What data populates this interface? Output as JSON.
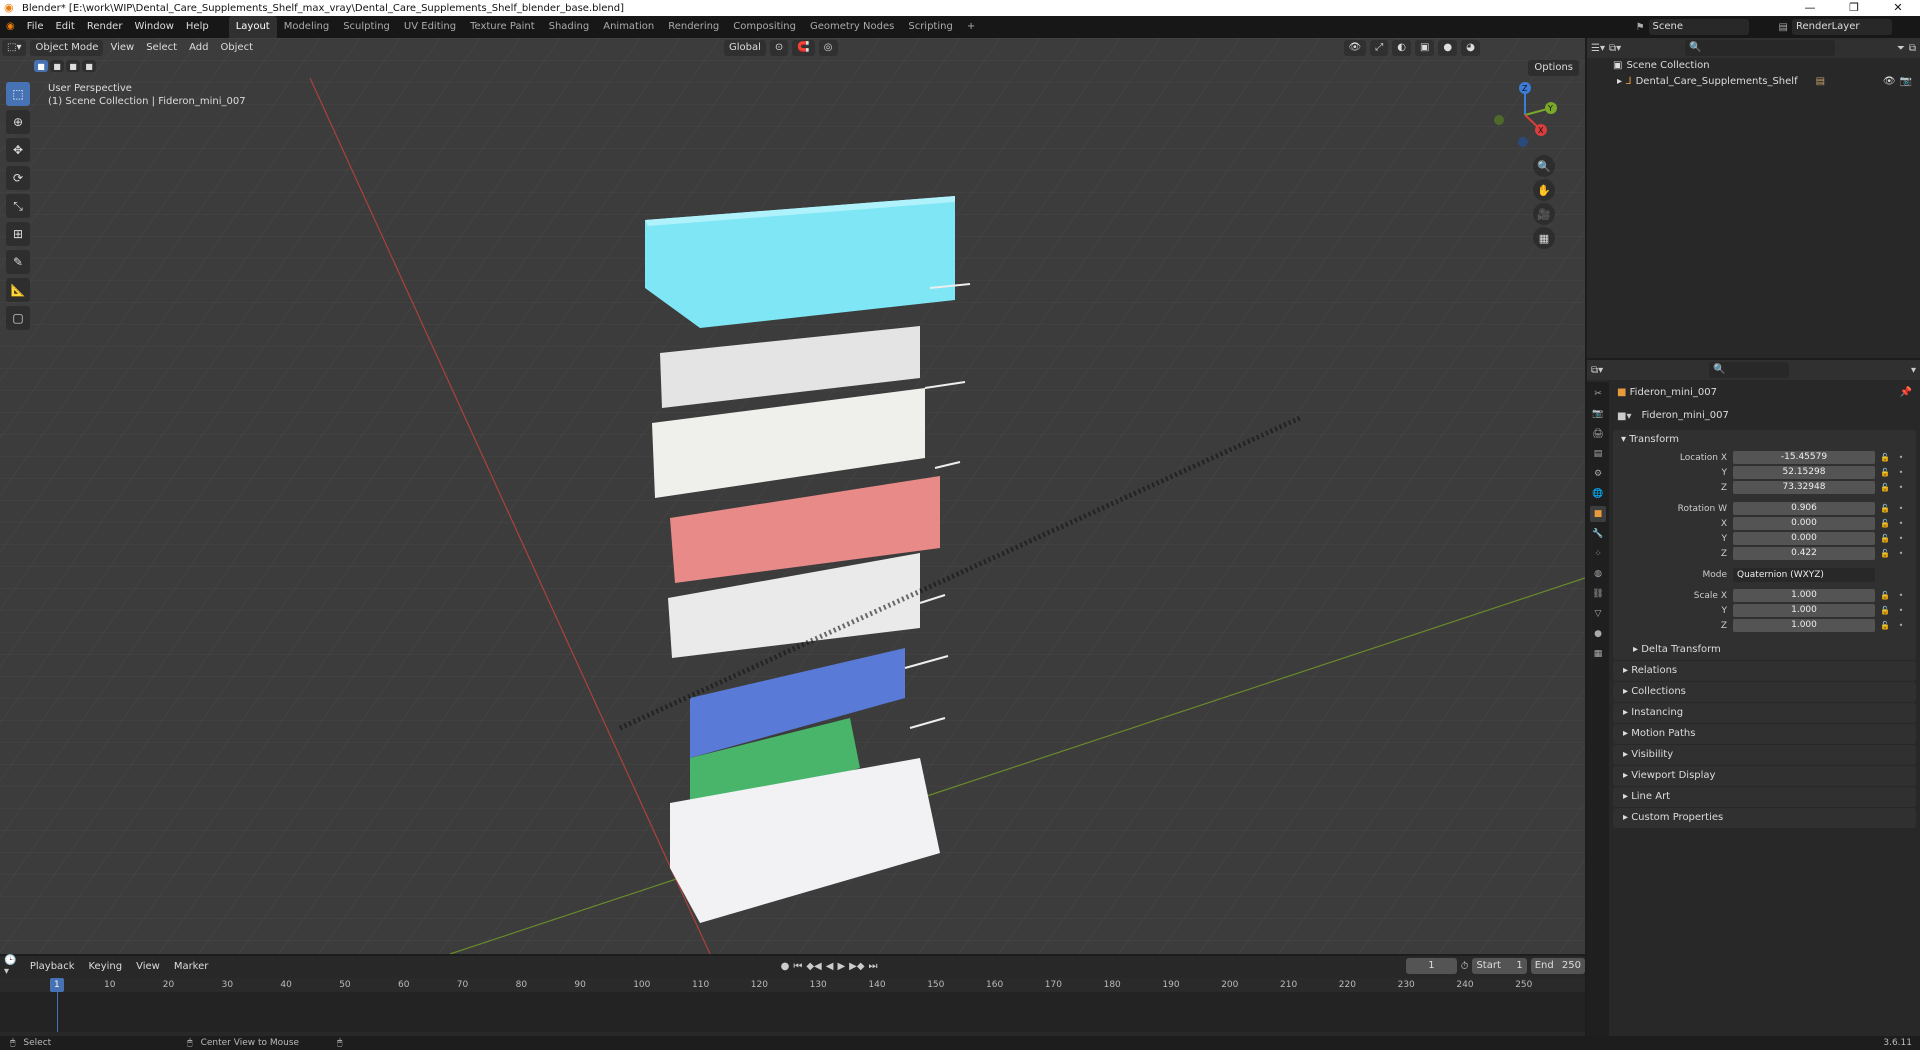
{
  "title": "Blender* [E:\\work\\WIP\\Dental_Care_Supplements_Shelf_max_vray\\Dental_Care_Supplements_Shelf_blender_base.blend]",
  "menu": [
    "File",
    "Edit",
    "Render",
    "Window",
    "Help"
  ],
  "workspaces": [
    "Layout",
    "Modeling",
    "Sculpting",
    "UV Editing",
    "Texture Paint",
    "Shading",
    "Animation",
    "Rendering",
    "Compositing",
    "Geometry Nodes",
    "Scripting",
    "+"
  ],
  "scene": "Scene",
  "render_layer": "RenderLayer",
  "viewport": {
    "mode": "Object Mode",
    "menus": [
      "View",
      "Select",
      "Add",
      "Object"
    ],
    "orientation": "Global",
    "options": "Options",
    "perspective": "User Perspective",
    "collection_info": "(1) Scene Collection | Fideron_mini_007",
    "axes": [
      "Z",
      "Y",
      "X"
    ]
  },
  "outliner": {
    "root": "Scene Collection",
    "items": [
      "Dental_Care_Supplements_Shelf"
    ]
  },
  "properties": {
    "object_name": "Fideron_mini_007",
    "object_field": "Fideron_mini_007",
    "transform_label": "Transform",
    "location": {
      "label": "Location X",
      "x": "-15.45579",
      "y": "52.15298",
      "z": "73.32948"
    },
    "rotation": {
      "label": "Rotation W",
      "w": "0.906",
      "x": "0.000",
      "y": "0.000",
      "z": "0.422"
    },
    "mode": {
      "label": "Mode",
      "value": "Quaternion (WXYZ)"
    },
    "scale": {
      "label": "Scale X",
      "x": "1.000",
      "y": "1.000",
      "z": "1.000"
    },
    "axis_labels": {
      "x": "X",
      "y": "Y",
      "z": "Z"
    },
    "delta": "Delta Transform",
    "panels": [
      "Relations",
      "Collections",
      "Instancing",
      "Motion Paths",
      "Visibility",
      "Viewport Display",
      "Line Art",
      "Custom Properties"
    ]
  },
  "timeline": {
    "menus": [
      "Playback",
      "Keying",
      "View",
      "Marker"
    ],
    "current_frame": "1",
    "start_label": "Start",
    "start": "1",
    "end_label": "End",
    "end": "250",
    "ticks": [
      "10",
      "20",
      "30",
      "40",
      "50",
      "60",
      "70",
      "80",
      "90",
      "100",
      "110",
      "120",
      "130",
      "140",
      "150",
      "160",
      "170",
      "180",
      "190",
      "200",
      "210",
      "220",
      "230",
      "240",
      "250"
    ],
    "playhead": "1"
  },
  "status": {
    "select": "Select",
    "center": "Center View to Mouse",
    "version": "3.6.11"
  }
}
